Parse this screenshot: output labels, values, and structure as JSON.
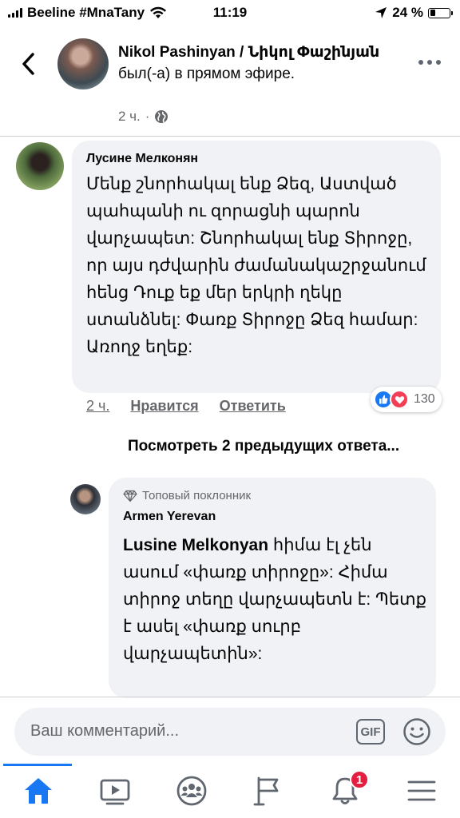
{
  "status_bar": {
    "carrier": "Beeline #MnaTany",
    "time": "11:19",
    "battery": "24 %"
  },
  "header": {
    "page_name": "Nikol Pashinyan / Նիկոլ Փաշինյան",
    "action_text": "был(-а) в прямом эфире.",
    "time_ago": "2 ч.",
    "separator": "·",
    "privacy_icon": "globe-icon"
  },
  "comments": [
    {
      "author": "Лусине Мелконян",
      "text": "Մենք շնորհակալ ենք Ձեզ, Աստված պահպանի ու զորացնի պարոն վարչապետ: Շնորհակալ ենք Տիրոջը, որ այս դժվարին ժամանակաշրջանում հենց Դուք եք մեր երկրի ղեկը ստանձնել:  Փառք Տիրոջը Ձեզ համար: Առողջ եղեք:",
      "time_ago": "2 ч.",
      "like_label": "Нравится",
      "reply_label": "Ответить",
      "reaction_count": "130",
      "reaction_icons": [
        "like-icon",
        "love-icon"
      ]
    }
  ],
  "view_more_replies": "Посмотреть 2 предыдущих ответа...",
  "reply": {
    "badge": "Топовый поклонник",
    "author": "Armen Yerevan",
    "mention": "Lusine  Melkonyan",
    "text": " հիմա էլ չեն ասում «փառք տիրոջը»: Հիմա տիրոջ տեղը վարչապետն է: Պետք է ասել «փառք սուրբ վարչապետին»:"
  },
  "composer": {
    "placeholder": "Ваш комментарий..."
  },
  "tabbar": {
    "tabs": [
      "home",
      "watch",
      "groups",
      "pages",
      "notifications",
      "menu"
    ],
    "active": "home",
    "notification_count": "1",
    "accent": "#1877f2"
  },
  "colors": {
    "bubble": "#f0f2f5",
    "secondary_text": "#65676b",
    "like_blue": "#1877f2",
    "love_red": "#f33e58",
    "badge_red": "#e41e3f"
  }
}
